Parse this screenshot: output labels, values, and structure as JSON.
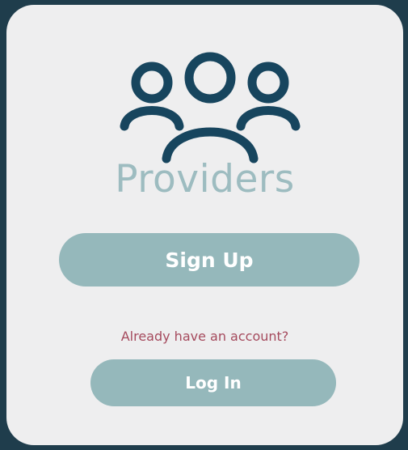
{
  "brand": {
    "name": "Providers",
    "icon": "users-group-icon"
  },
  "actions": {
    "signup_label": "Sign Up",
    "login_prompt": "Already have an account?",
    "login_label": "Log In"
  },
  "colors": {
    "background": "#1f3d4c",
    "card": "#eeeeef",
    "icon": "#17455e",
    "brand_text": "#9dbcc0",
    "button": "#95b8bb",
    "button_text": "#ffffff",
    "prompt_text": "#a54a5d"
  }
}
